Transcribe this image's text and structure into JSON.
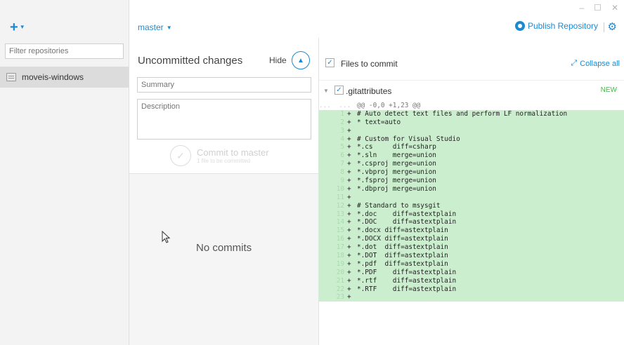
{
  "window": {
    "controls": [
      "–",
      "☐",
      "✕"
    ]
  },
  "sidebar": {
    "add_icon": "plus-icon",
    "filter_placeholder": "Filter repositories",
    "repos": [
      {
        "label": "moveis-windows"
      }
    ]
  },
  "topbar": {
    "branch": "master",
    "publish_label": "Publish Repository"
  },
  "commit": {
    "title": "Uncommitted changes",
    "hide_label": "Hide",
    "summary_placeholder": "Summary",
    "description_placeholder": "Description",
    "commit_label": "Commit to master",
    "commit_sub": "1 file to be committed"
  },
  "history": {
    "empty_text": "No commits"
  },
  "diff": {
    "files_title": "Files to commit",
    "collapse_label": "Collapse all",
    "file_name": ".gitattributes",
    "file_status": "NEW",
    "hunk_prefix": "...  ...",
    "hunk": "@@ -0,0 +1,23 @@",
    "lines": [
      "# Auto detect text files and perform LF normalization",
      "* text=auto",
      "",
      "# Custom for Visual Studio",
      "*.cs     diff=csharp",
      "*.sln    merge=union",
      "*.csproj merge=union",
      "*.vbproj merge=union",
      "*.fsproj merge=union",
      "*.dbproj merge=union",
      "",
      "# Standard to msysgit",
      "*.doc    diff=astextplain",
      "*.DOC    diff=astextplain",
      "*.docx diff=astextplain",
      "*.DOCX diff=astextplain",
      "*.dot  diff=astextplain",
      "*.DOT  diff=astextplain",
      "*.pdf  diff=astextplain",
      "*.PDF    diff=astextplain",
      "*.rtf    diff=astextplain",
      "*.RTF    diff=astextplain",
      ""
    ]
  },
  "colors": {
    "accent": "#1b8ad3",
    "added_bg": "#cbefce",
    "new_badge": "#49b649"
  }
}
